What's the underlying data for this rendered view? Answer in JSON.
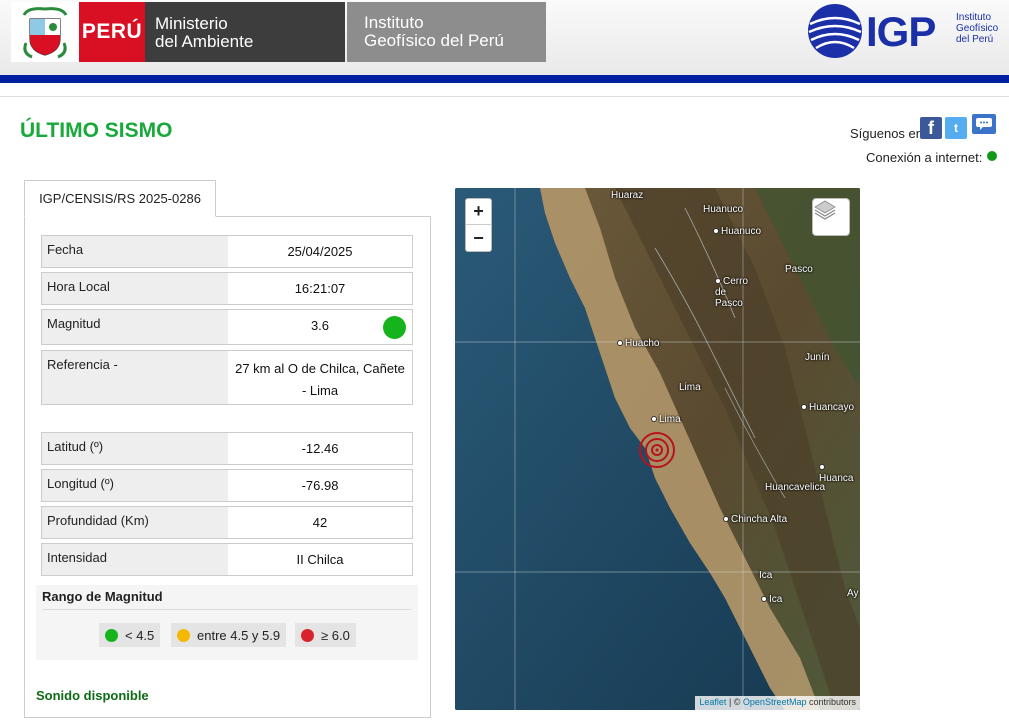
{
  "header": {
    "peru_label": "PERÚ",
    "minam_line1": "Ministerio",
    "minam_line2": "del Ambiente",
    "igp_line1": "Instituto",
    "igp_line2": "Geofísico del Perú",
    "logo_text": "IGP",
    "logo_small1": "Instituto",
    "logo_small2": "Geofísico",
    "logo_small3": "del Perú",
    "brand_color": "#001ea0"
  },
  "page": {
    "title": "ÚLTIMO SISMO",
    "siguenos": "Síguenos en:",
    "conexion": "Conexión a internet:",
    "title_color": "#19a83a"
  },
  "report": {
    "tab_label": "IGP/CENSIS/RS 2025-0286",
    "rows": [
      {
        "label": "Fecha",
        "value": "25/04/2025"
      },
      {
        "label": "Hora Local",
        "value": "16:21:07"
      },
      {
        "label": "Magnitud",
        "value": "3.6"
      },
      {
        "label": "Referencia -",
        "value": "27 km al O de Chilca, Cañete - Lima"
      },
      {
        "label": "Latitud (º)",
        "value": "-12.46"
      },
      {
        "label": "Longitud (º)",
        "value": "-76.98"
      },
      {
        "label": "Profundidad (Km)",
        "value": "42"
      },
      {
        "label": "Intensidad",
        "value": "II Chilca"
      }
    ],
    "magnitude_color": "#15b41c"
  },
  "rango": {
    "title": "Rango de Magnitud",
    "items": [
      {
        "label": "< 4.5",
        "color": "#15b41c"
      },
      {
        "label": "entre 4.5 y 5.9",
        "color": "#f5b800"
      },
      {
        "label": "≥ 6.0",
        "color": "#d8232a"
      }
    ]
  },
  "sonido": "Sonido disponible",
  "map": {
    "zoom_in": "+",
    "zoom_out": "−",
    "attribution_leaflet": "Leaflet",
    "attribution_sep": " | © ",
    "attribution_osm": "OpenStreetMap",
    "attribution_rest": " contributors",
    "cities": [
      "Huaraz",
      "Huanuco",
      "Huanuco",
      "Pasco",
      "Cerro de Pasco",
      "Huacho",
      "Lima",
      "Lima",
      "Junín",
      "Huancayo",
      "Huanca",
      "Huancavelica",
      "Chincha Alta",
      "Ica",
      "Ica",
      "Ay"
    ]
  }
}
